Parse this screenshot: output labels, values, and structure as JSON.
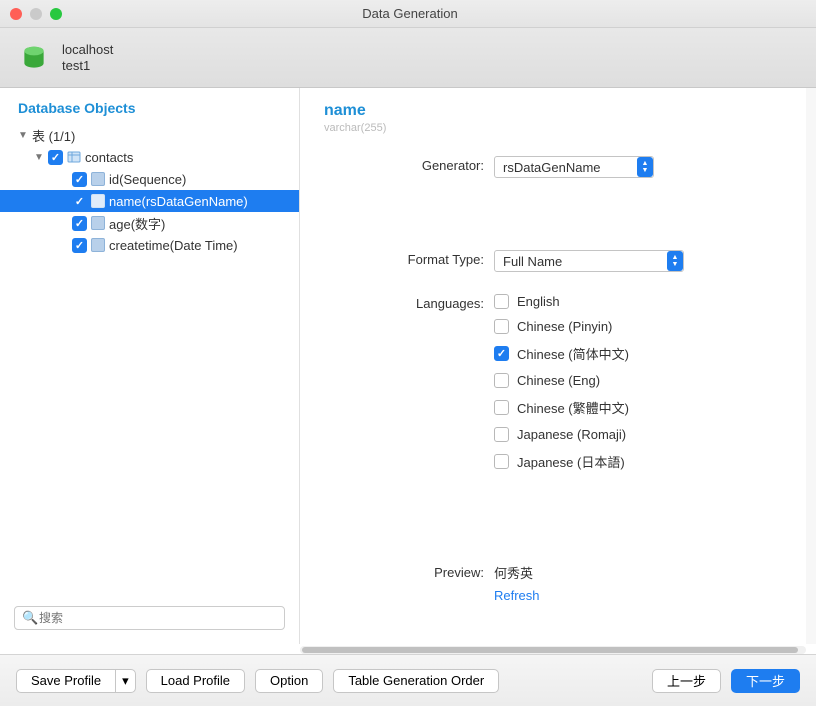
{
  "window": {
    "title": "Data Generation"
  },
  "header": {
    "host": "localhost",
    "database": "test1"
  },
  "sidebar": {
    "title": "Database Objects",
    "root": {
      "label": "表 (1/1)"
    },
    "table": {
      "label": "contacts"
    },
    "columns": [
      {
        "label": "id(Sequence)",
        "checked": true,
        "selected": false
      },
      {
        "label": "name(rsDataGenName)",
        "checked": true,
        "selected": true
      },
      {
        "label": "age(数字)",
        "checked": true,
        "selected": false
      },
      {
        "label": "createtime(Date Time)",
        "checked": true,
        "selected": false
      }
    ],
    "search_placeholder": "搜索"
  },
  "detail": {
    "field_name": "name",
    "field_type": "varchar(255)",
    "labels": {
      "generator": "Generator:",
      "format_type": "Format Type:",
      "languages": "Languages:",
      "preview": "Preview:"
    },
    "generator": "rsDataGenName",
    "format_type": "Full Name",
    "languages": [
      {
        "label": "English",
        "checked": false
      },
      {
        "label": "Chinese (Pinyin)",
        "checked": false
      },
      {
        "label": "Chinese (简体中文)",
        "checked": true
      },
      {
        "label": "Chinese (Eng)",
        "checked": false
      },
      {
        "label": "Chinese (繁體中文)",
        "checked": false
      },
      {
        "label": "Japanese (Romaji)",
        "checked": false
      },
      {
        "label": "Japanese (日本語)",
        "checked": false
      }
    ],
    "preview_value": "何秀英",
    "refresh_label": "Refresh"
  },
  "footer": {
    "save_profile": "Save Profile",
    "load_profile": "Load Profile",
    "option": "Option",
    "table_gen_order": "Table Generation Order",
    "prev": "上一步",
    "next": "下一步"
  }
}
